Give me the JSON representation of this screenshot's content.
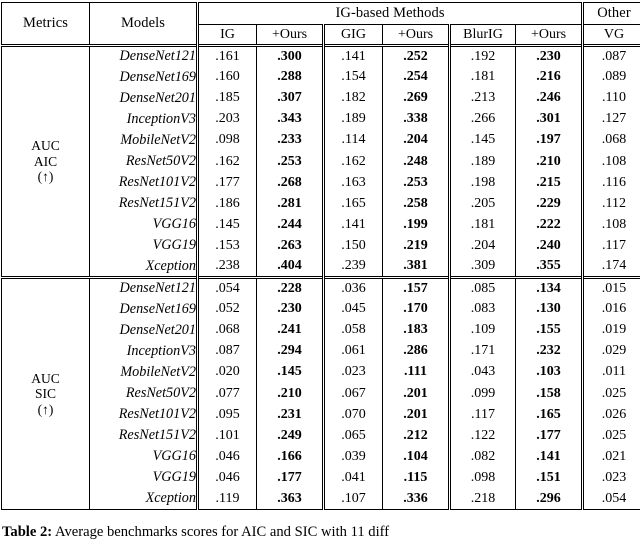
{
  "table": {
    "header": {
      "metrics_label": "Metrics",
      "models_label": "Models",
      "group_ig_label": "IG-based Methods",
      "group_other_label": "Other",
      "subcolumns": [
        "IG",
        "+Ours",
        "GIG",
        "+Ours",
        "BlurIG",
        "+Ours",
        "VG"
      ]
    },
    "blocks": [
      {
        "metric_lines": [
          "AUC",
          "AIC",
          "(↑)"
        ],
        "rows": [
          {
            "model": "DenseNet121",
            "values": [
              ".161",
              ".300",
              ".141",
              ".252",
              ".192",
              ".230",
              ".087"
            ]
          },
          {
            "model": "DenseNet169",
            "values": [
              ".160",
              ".288",
              ".154",
              ".254",
              ".181",
              ".216",
              ".089"
            ]
          },
          {
            "model": "DenseNet201",
            "values": [
              ".185",
              ".307",
              ".182",
              ".269",
              ".213",
              ".246",
              ".110"
            ]
          },
          {
            "model": "InceptionV3",
            "values": [
              ".203",
              ".343",
              ".189",
              ".338",
              ".266",
              ".301",
              ".127"
            ]
          },
          {
            "model": "MobileNetV2",
            "values": [
              ".098",
              ".233",
              ".114",
              ".204",
              ".145",
              ".197",
              ".068"
            ]
          },
          {
            "model": "ResNet50V2",
            "values": [
              ".162",
              ".253",
              ".162",
              ".248",
              ".189",
              ".210",
              ".108"
            ]
          },
          {
            "model": "ResNet101V2",
            "values": [
              ".177",
              ".268",
              ".163",
              ".253",
              ".198",
              ".215",
              ".116"
            ]
          },
          {
            "model": "ResNet151V2",
            "values": [
              ".186",
              ".281",
              ".165",
              ".258",
              ".205",
              ".229",
              ".112"
            ]
          },
          {
            "model": "VGG16",
            "values": [
              ".145",
              ".244",
              ".141",
              ".199",
              ".181",
              ".222",
              ".108"
            ]
          },
          {
            "model": "VGG19",
            "values": [
              ".153",
              ".263",
              ".150",
              ".219",
              ".204",
              ".240",
              ".117"
            ]
          },
          {
            "model": "Xception",
            "values": [
              ".238",
              ".404",
              ".239",
              ".381",
              ".309",
              ".355",
              ".174"
            ]
          }
        ]
      },
      {
        "metric_lines": [
          "AUC",
          "SIC",
          "(↑)"
        ],
        "rows": [
          {
            "model": "DenseNet121",
            "values": [
              ".054",
              ".228",
              ".036",
              ".157",
              ".085",
              ".134",
              ".015"
            ]
          },
          {
            "model": "DenseNet169",
            "values": [
              ".052",
              ".230",
              ".045",
              ".170",
              ".083",
              ".130",
              ".016"
            ]
          },
          {
            "model": "DenseNet201",
            "values": [
              ".068",
              ".241",
              ".058",
              ".183",
              ".109",
              ".155",
              ".019"
            ]
          },
          {
            "model": "InceptionV3",
            "values": [
              ".087",
              ".294",
              ".061",
              ".286",
              ".171",
              ".232",
              ".029"
            ]
          },
          {
            "model": "MobileNetV2",
            "values": [
              ".020",
              ".145",
              ".023",
              ".111",
              ".043",
              ".103",
              ".011"
            ]
          },
          {
            "model": "ResNet50V2",
            "values": [
              ".077",
              ".210",
              ".067",
              ".201",
              ".099",
              ".158",
              ".025"
            ]
          },
          {
            "model": "ResNet101V2",
            "values": [
              ".095",
              ".231",
              ".070",
              ".201",
              ".117",
              ".165",
              ".026"
            ]
          },
          {
            "model": "ResNet151V2",
            "values": [
              ".101",
              ".249",
              ".065",
              ".212",
              ".122",
              ".177",
              ".025"
            ]
          },
          {
            "model": "VGG16",
            "values": [
              ".046",
              ".166",
              ".039",
              ".104",
              ".082",
              ".141",
              ".021"
            ]
          },
          {
            "model": "VGG19",
            "values": [
              ".046",
              ".177",
              ".041",
              ".115",
              ".098",
              ".151",
              ".023"
            ]
          },
          {
            "model": "Xception",
            "values": [
              ".119",
              ".363",
              ".107",
              ".336",
              ".218",
              ".296",
              ".054"
            ]
          }
        ]
      }
    ],
    "bold_value_columns": [
      1,
      3,
      5
    ]
  },
  "caption": {
    "label": "Table 2:",
    "text": " Average benchmarks scores for AIC and SIC with 11 diff"
  }
}
